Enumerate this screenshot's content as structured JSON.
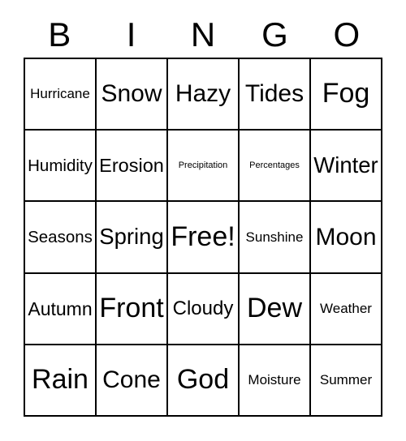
{
  "card": {
    "title_letters": [
      "B",
      "I",
      "N",
      "G",
      "O"
    ],
    "columns": 5,
    "rows": 5,
    "border_color": "#000000",
    "background_color": "#ffffff",
    "text_color": "#000000",
    "free_space_label": "Free!",
    "free_space_position": {
      "row": 3,
      "column": 3
    },
    "cells": [
      [
        {
          "label": "Hurricane",
          "size": "sm"
        },
        {
          "label": "Snow",
          "size": "lg"
        },
        {
          "label": "Hazy",
          "size": "lg"
        },
        {
          "label": "Tides",
          "size": "lg"
        },
        {
          "label": "Fog",
          "size": "xl"
        }
      ],
      [
        {
          "label": "Humidity",
          "size": "md"
        },
        {
          "label": "Erosion",
          "size": "md"
        },
        {
          "label": "Precipitation",
          "size": "xxs"
        },
        {
          "label": "Percentages",
          "size": "xxs"
        },
        {
          "label": "Winter",
          "size": "lg"
        }
      ],
      [
        {
          "label": "Seasons",
          "size": "md"
        },
        {
          "label": "Spring",
          "size": "lg"
        },
        {
          "label": "Free!",
          "size": "xl"
        },
        {
          "label": "Sunshine",
          "size": "sm"
        },
        {
          "label": "Moon",
          "size": "lg"
        }
      ],
      [
        {
          "label": "Autumn",
          "size": "md"
        },
        {
          "label": "Front",
          "size": "xl"
        },
        {
          "label": "Cloudy",
          "size": "md"
        },
        {
          "label": "Dew",
          "size": "xl"
        },
        {
          "label": "Weather",
          "size": "sm"
        }
      ],
      [
        {
          "label": "Rain",
          "size": "xl"
        },
        {
          "label": "Cone",
          "size": "lg"
        },
        {
          "label": "God",
          "size": "xl"
        },
        {
          "label": "Moisture",
          "size": "sm"
        },
        {
          "label": "Summer",
          "size": "sm"
        }
      ]
    ]
  }
}
